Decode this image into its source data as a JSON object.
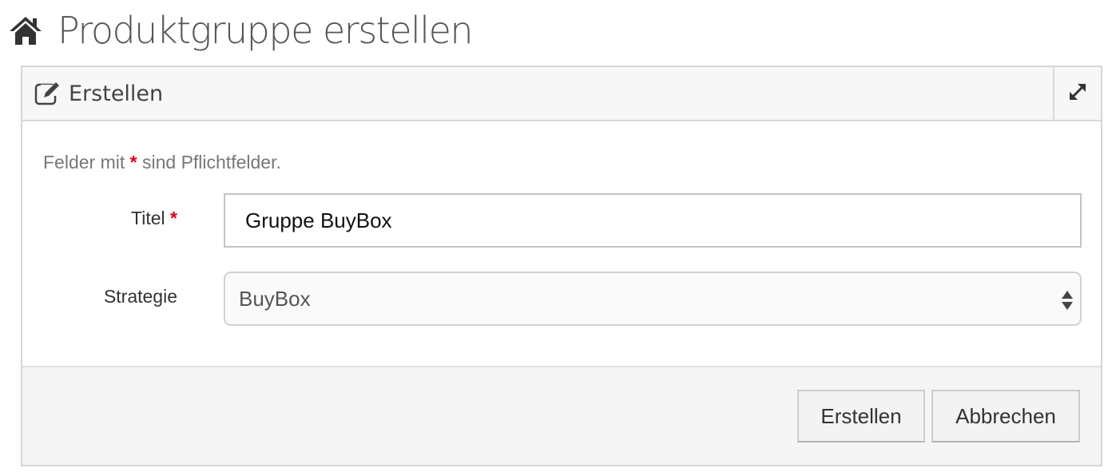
{
  "header": {
    "title": "Produktgruppe erstellen",
    "icon": "home-icon"
  },
  "panel": {
    "title": "Erstellen",
    "title_icon": "edit-icon",
    "expand_icon": "expand-icon"
  },
  "form": {
    "note_prefix": "Felder mit ",
    "note_star": "*",
    "note_suffix": " sind Pflichtfelder.",
    "titel_label": "Titel",
    "titel_required": "*",
    "titel_value": "Gruppe BuyBox",
    "strategie_label": "Strategie",
    "strategie_value": "BuyBox"
  },
  "footer": {
    "create_label": "Erstellen",
    "cancel_label": "Abbrechen"
  },
  "colors": {
    "required": "#d9001b",
    "panel_heading_bg": "#f7f7f7",
    "footer_bg": "#f5f5f5"
  }
}
